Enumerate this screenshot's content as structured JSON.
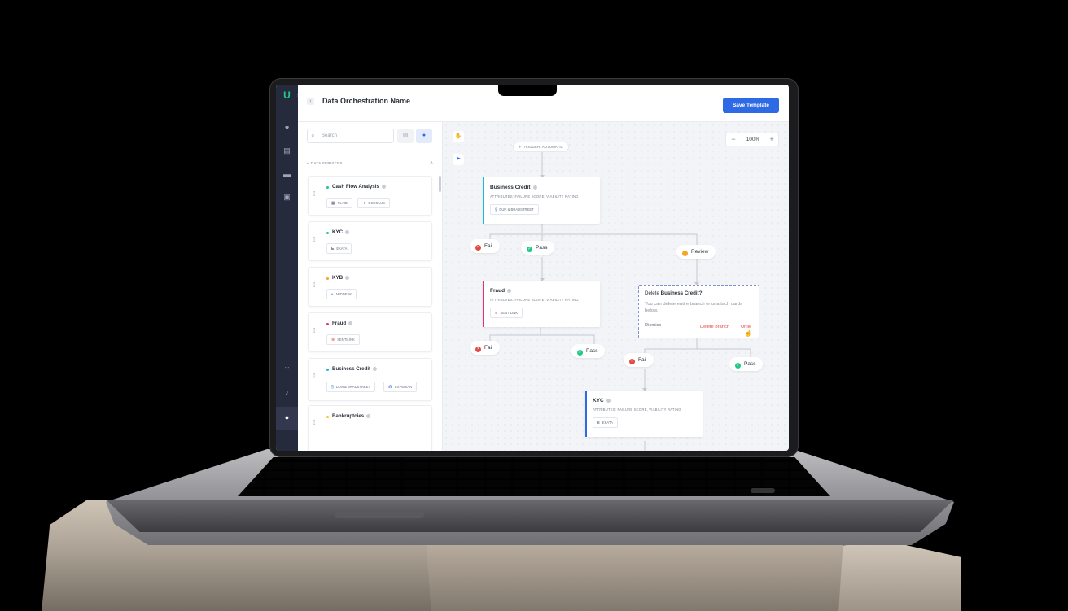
{
  "app": {
    "logo": "U",
    "page_title": "Data Orchestration Name",
    "save_button": "Save Template",
    "back_icon": "chevron-left-icon",
    "collapse_icon": "chevron-right-icon"
  },
  "rail": {
    "icons": [
      "heart-rate-icon",
      "clipboard-icon",
      "briefcase-icon",
      "archive-icon",
      "apps-icon",
      "bell-icon",
      "user-circle-icon"
    ]
  },
  "library": {
    "search_placeholder": "Search",
    "section_title": "DATA SERVICES",
    "cards": [
      {
        "name": "Cash Flow Analysis",
        "dot_color": "#22c986",
        "chips": [
          {
            "icon": "plaid-icon",
            "glyph": "▦",
            "label": "PLAID"
          },
          {
            "icon": "ocrolus-icon",
            "glyph": "➔",
            "label": "OCROLUS"
          }
        ]
      },
      {
        "name": "KYC",
        "dot_color": "#22c986",
        "chips": [
          {
            "icon": "ekata-icon",
            "glyph": "E",
            "label": "EKATA"
          }
        ]
      },
      {
        "name": "KYB",
        "dot_color": "#f5a623",
        "chips": [
          {
            "icon": "middesk-icon",
            "glyph": "◐",
            "label": "MIDDESK"
          }
        ]
      },
      {
        "name": "Fraud",
        "dot_color": "#e0337a",
        "chips": [
          {
            "icon": "sentilink-icon",
            "glyph": "⊛",
            "label": "SENTILINK"
          }
        ]
      },
      {
        "name": "Business Credit",
        "dot_color": "#22b6d6",
        "chips": [
          {
            "icon": "dun-bradstreet-icon",
            "glyph": "§",
            "label": "DUN & BRADSTREET"
          },
          {
            "icon": "experian-icon",
            "glyph": "⁂",
            "label": "EXPERIAN"
          }
        ]
      },
      {
        "name": "Bankruptcies",
        "dot_color": "#f5c623",
        "chips": []
      }
    ]
  },
  "canvas": {
    "zoom": "100%",
    "zoom_out": "−",
    "zoom_in": "+",
    "trigger": "TRIGGER: AUTOMATIC",
    "nodes": {
      "business_credit": {
        "title": "Business Credit",
        "attributes": "ATTRIBUTES: FAILURE SCORE, VIABILITY RATING",
        "chip": "DUN & BRADSTREET",
        "chip_glyph": "§",
        "accent": "#22b6d6"
      },
      "fraud": {
        "title": "Fraud",
        "attributes": "ATTRIBUTES: FAILURE SCORE, VIABILITY RATING",
        "chip": "SENTILINK",
        "chip_glyph": "⊛",
        "accent": "#e0337a"
      },
      "kyc": {
        "title": "KYC",
        "attributes": "ATTRIBUTES: FAILURE SCORE, VIABILITY RATING",
        "chip": "EKATA",
        "chip_glyph": "E",
        "accent": "#2d6ae3"
      }
    },
    "outcomes": {
      "fail": "Fail",
      "pass": "Pass",
      "review": "Review",
      "fail_color": "#e04848",
      "pass_color": "#22c986",
      "review_color": "#f5a623"
    },
    "popover": {
      "title_prefix": "Delete ",
      "title_bold": "Business Credit?",
      "body": "You can delete entire branch or unattach cards below.",
      "dismiss": "Dismiss",
      "delete_branch": "Delete branch",
      "unlink": "Unlie"
    }
  }
}
